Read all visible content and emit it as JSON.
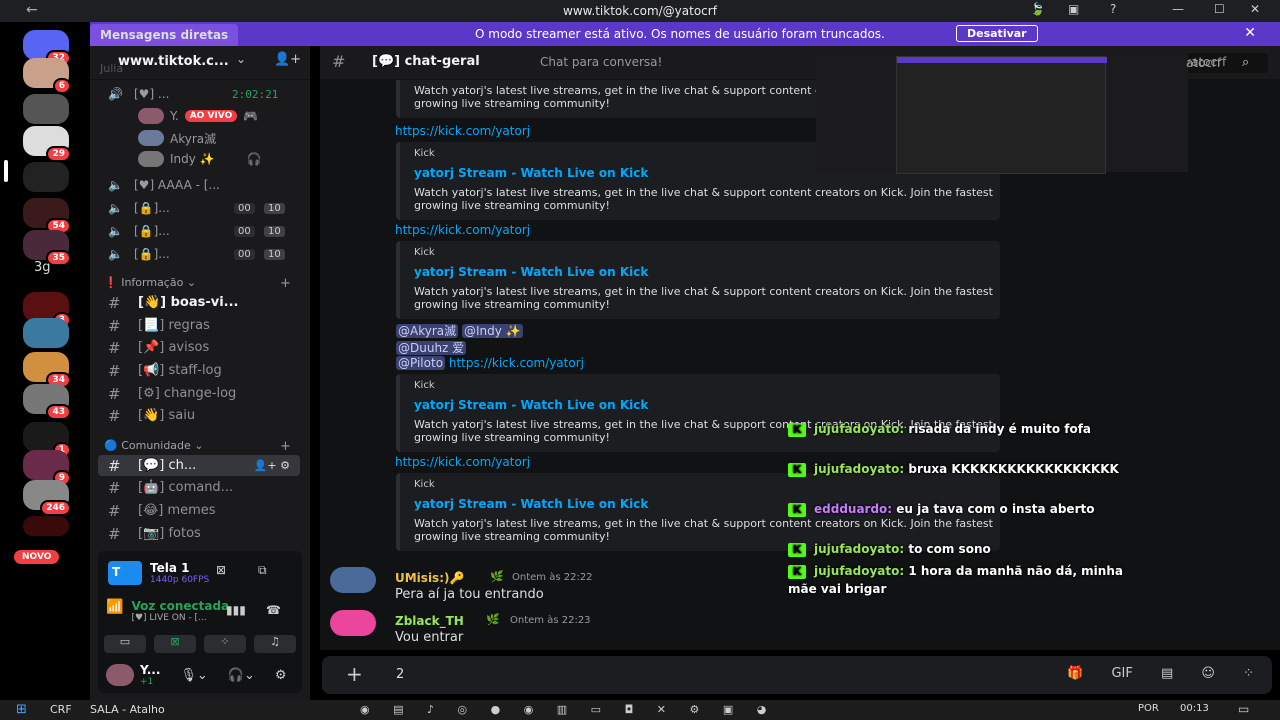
{
  "browser": {
    "url": "www.tiktok.com/@yatocrf"
  },
  "guilds": {
    "badges": [
      "32",
      "6",
      "29",
      "54",
      "35",
      "3",
      "34",
      "43",
      "1",
      "9",
      "246"
    ],
    "text_item": "3g",
    "new_label": "NOVO"
  },
  "streamer": {
    "dm_tab": "Mensagens diretas",
    "message": "O modo streamer está ativo. Os nomes de usuário foram truncados.",
    "disable_button": "Desativar"
  },
  "sidebar": {
    "server_name": "www.tiktok.c...",
    "ghost_label": "Julia",
    "voice_channels": [
      {
        "name": "[♥] ...",
        "time": "2:02:21"
      },
      {
        "name": "[♥] AAAA - [..."
      },
      {
        "name": "[🔒]...",
        "c1": "00",
        "c2": "10"
      },
      {
        "name": "[🔒]...",
        "c1": "00",
        "c2": "10"
      },
      {
        "name": "[🔒]...",
        "c1": "00",
        "c2": "10"
      }
    ],
    "voice_users": [
      {
        "name": "Y.",
        "badge": "AO VIVO"
      },
      {
        "name": "Akyra滅"
      },
      {
        "name": "Indy ✨"
      }
    ],
    "categories": [
      "Informação",
      "Comunidade"
    ],
    "info_channels": [
      "[👋] boas-vi...",
      "[📃] regras",
      "[📌] avisos",
      "[📢] staff-log",
      "[⚙] change-log",
      "[👋] saiu"
    ],
    "community_channels": [
      "[💬] ch...",
      "[🤖] comand...",
      "[😂] memes",
      "[📷] fotos"
    ]
  },
  "panel": {
    "screen_title": "Tela 1",
    "screen_quality": "1440p 60FPS",
    "voice_status": "Voz conectada",
    "voice_channel": "[♥] LIVE ON - [...",
    "username": "Y...",
    "user_status": "+1"
  },
  "channel": {
    "name": "[💬] chat-geral",
    "topic": "Chat para conversa!",
    "search_placeholder": "yatocrf"
  },
  "messages": {
    "link": "https://kick.com/yatorj",
    "embed_provider": "Kick",
    "embed_title": "yatorj Stream - Watch Live on Kick",
    "embed_desc": "Watch yatorj's latest live streams, get in the live chat & support content creators on Kick. Join the fastest growing live streaming community!",
    "mentions_line1": [
      "@Akyra滅",
      "@Indy ✨"
    ],
    "mentions_line2": "@Duuhz 爱",
    "mentions_line3": "@Piloto",
    "msg1": {
      "author": "UMisis:)🔑",
      "time": "Ontem às 22:22",
      "text": "Pera aí ja tou entrando"
    },
    "msg2": {
      "author": "Zblack_TH",
      "time": "Ontem às 22:23",
      "text": "Vou entrar"
    }
  },
  "composer": {
    "value": "2"
  },
  "overlay": {
    "search_text": "atocrf"
  },
  "kick_chat": [
    {
      "user": "jujufadoyato:",
      "text": "risada da indy é muito fofa"
    },
    {
      "user": "jujufadoyato:",
      "text": "bruxa KKKKKKKKKKKKKKKKKK"
    },
    {
      "user": "eddduardo:",
      "text": "eu ja tava com o insta aberto"
    },
    {
      "user": "jujufadoyato:",
      "text": "to com sono"
    },
    {
      "user": "jujufadoyato:",
      "text": "1 hora da manhã não dá, minha mãe vai brigar"
    }
  ],
  "taskbar": {
    "crf": "CRF",
    "window": "SALA - Atalho",
    "lang": "POR",
    "clock": "00:13"
  },
  "colors": {
    "accent": "#5865f2",
    "streamer_bar": "#5c38c9",
    "link": "#00a8fc",
    "kick": "#53fc18",
    "online": "#23a559",
    "badge": "#f23f43"
  }
}
